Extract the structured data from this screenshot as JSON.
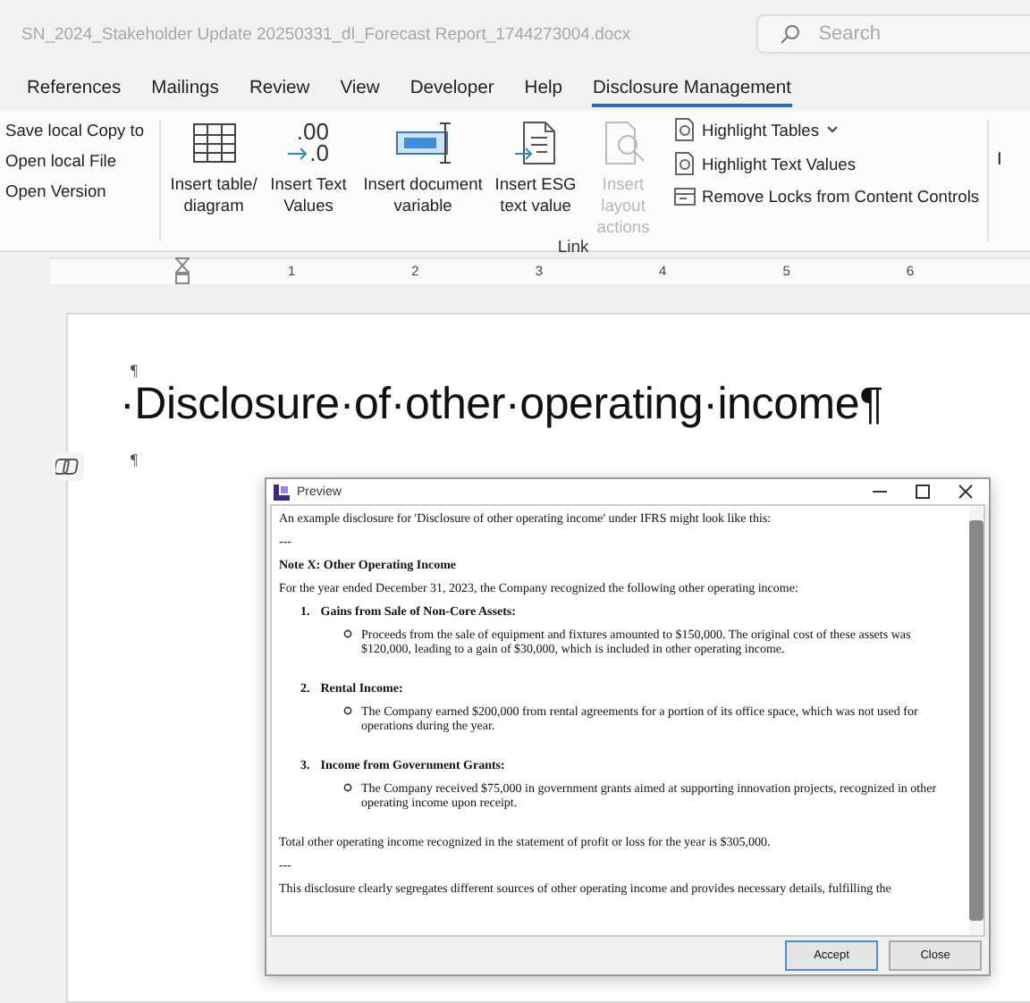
{
  "title_bar": {
    "document_name": "SN_2024_Stakeholder Update 20250331_dl_Forecast Report_1744273004.docx",
    "search": {
      "placeholder": "Search"
    }
  },
  "tabs": [
    {
      "label": "References",
      "selected": false
    },
    {
      "label": "Mailings",
      "selected": false
    },
    {
      "label": "Review",
      "selected": false
    },
    {
      "label": "View",
      "selected": false
    },
    {
      "label": "Developer",
      "selected": false
    },
    {
      "label": "Help",
      "selected": false
    },
    {
      "label": "Disclosure Management",
      "selected": true
    }
  ],
  "ribbon": {
    "file_actions": [
      "Save local Copy to",
      "Open local File",
      "Open Version"
    ],
    "link_group": {
      "label": "Link",
      "buttons": [
        {
          "kind": "table",
          "label": "Insert table/ diagram",
          "disabled": false
        },
        {
          "kind": "decimal",
          "glyph_top": ".00",
          "glyph_bottom": ".0",
          "label": "Insert Text Values",
          "disabled": false
        },
        {
          "kind": "variable",
          "label": "Insert document variable",
          "disabled": false
        },
        {
          "kind": "esg",
          "label": "Insert ESG text value",
          "disabled": false
        },
        {
          "kind": "layout",
          "label": "Insert layout actions",
          "disabled": true
        }
      ],
      "side_buttons": [
        {
          "label": "Highlight Tables",
          "dropdown": true,
          "kind": "highlight"
        },
        {
          "label": "Highlight Text Values",
          "dropdown": false,
          "kind": "highlight"
        },
        {
          "label": "Remove Locks from Content Controls",
          "dropdown": false,
          "kind": "unlock"
        }
      ]
    },
    "next_group_label": "I"
  },
  "ruler": {
    "numbers": [
      "1",
      "2",
      "3",
      "4",
      "5",
      "6"
    ]
  },
  "document": {
    "marks_before": "¶",
    "heading": "·Disclosure·of·other·operating·income¶",
    "marks_after": "¶"
  },
  "dialog": {
    "title": "Preview",
    "content": [
      {
        "kind": "para",
        "text": "An example disclosure for 'Disclosure of other operating income' under IFRS might look like this:"
      },
      {
        "kind": "sep",
        "text": "---"
      },
      {
        "kind": "heading",
        "text": "Note X: Other Operating Income"
      },
      {
        "kind": "para",
        "text": "For the year ended December 31, 2023, the Company recognized the following other operating income:"
      },
      {
        "kind": "item",
        "number": "1.",
        "title": "Gains from Sale of Non-Core Assets:",
        "bullet": "Proceeds from the sale of equipment and fixtures amounted to $150,000. The original cost of these assets was $120,000, leading to a gain of $30,000, which is included in other operating income."
      },
      {
        "kind": "item",
        "number": "2.",
        "title": "Rental Income:",
        "bullet": "The Company earned $200,000 from rental agreements for a portion of its office space, which was not used for operations during the year."
      },
      {
        "kind": "item",
        "number": "3.",
        "title": "Income from Government Grants:",
        "bullet": "The Company received $75,000 in government grants aimed at supporting innovation projects, recognized in other operating income upon receipt."
      },
      {
        "kind": "para",
        "text": "Total other operating income recognized in the statement of profit or loss for the year is $305,000."
      },
      {
        "kind": "sep",
        "text": "---"
      },
      {
        "kind": "para",
        "text": "This disclosure clearly segregates different sources of other operating income and provides necessary details, fulfilling the"
      }
    ],
    "buttons": [
      {
        "label": "Accept",
        "default": true
      },
      {
        "label": "Close",
        "default": false
      }
    ]
  }
}
